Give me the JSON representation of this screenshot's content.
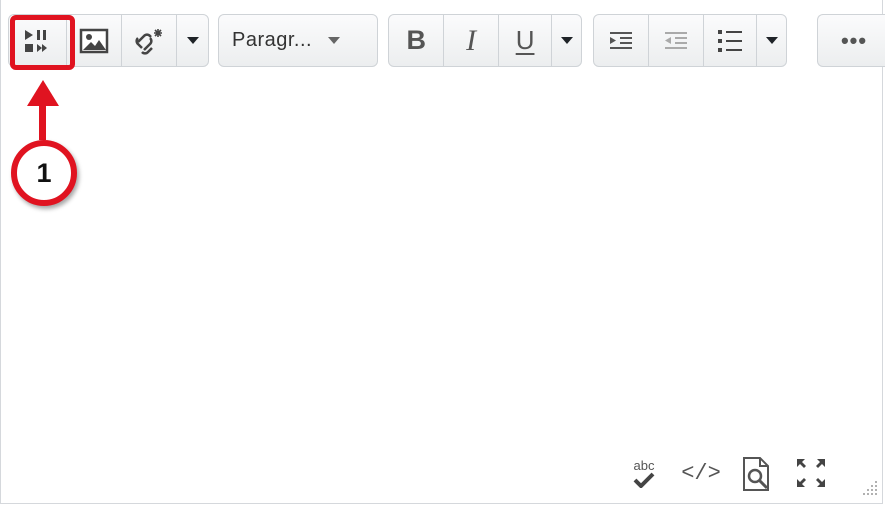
{
  "toolbar": {
    "insert_stuff": "insert-stuff-icon",
    "insert_image": "image-icon",
    "insert_quicklink": "quicklink-icon",
    "paragraph_style": "Paragr...",
    "bold_label": "B",
    "italic_label": "I",
    "underline_label": "U",
    "indent": "indent-icon",
    "outdent": "outdent-icon",
    "bullet_list": "bullet-list-icon",
    "more_label": "•••"
  },
  "annotation": {
    "step_number": "1",
    "color": "#e01320"
  },
  "status_bar": {
    "spellcheck_label": "abc",
    "source_code_label": "</>",
    "preview": "preview-icon",
    "fullscreen": "fullscreen-icon",
    "resize": "resize-handle-icon"
  }
}
